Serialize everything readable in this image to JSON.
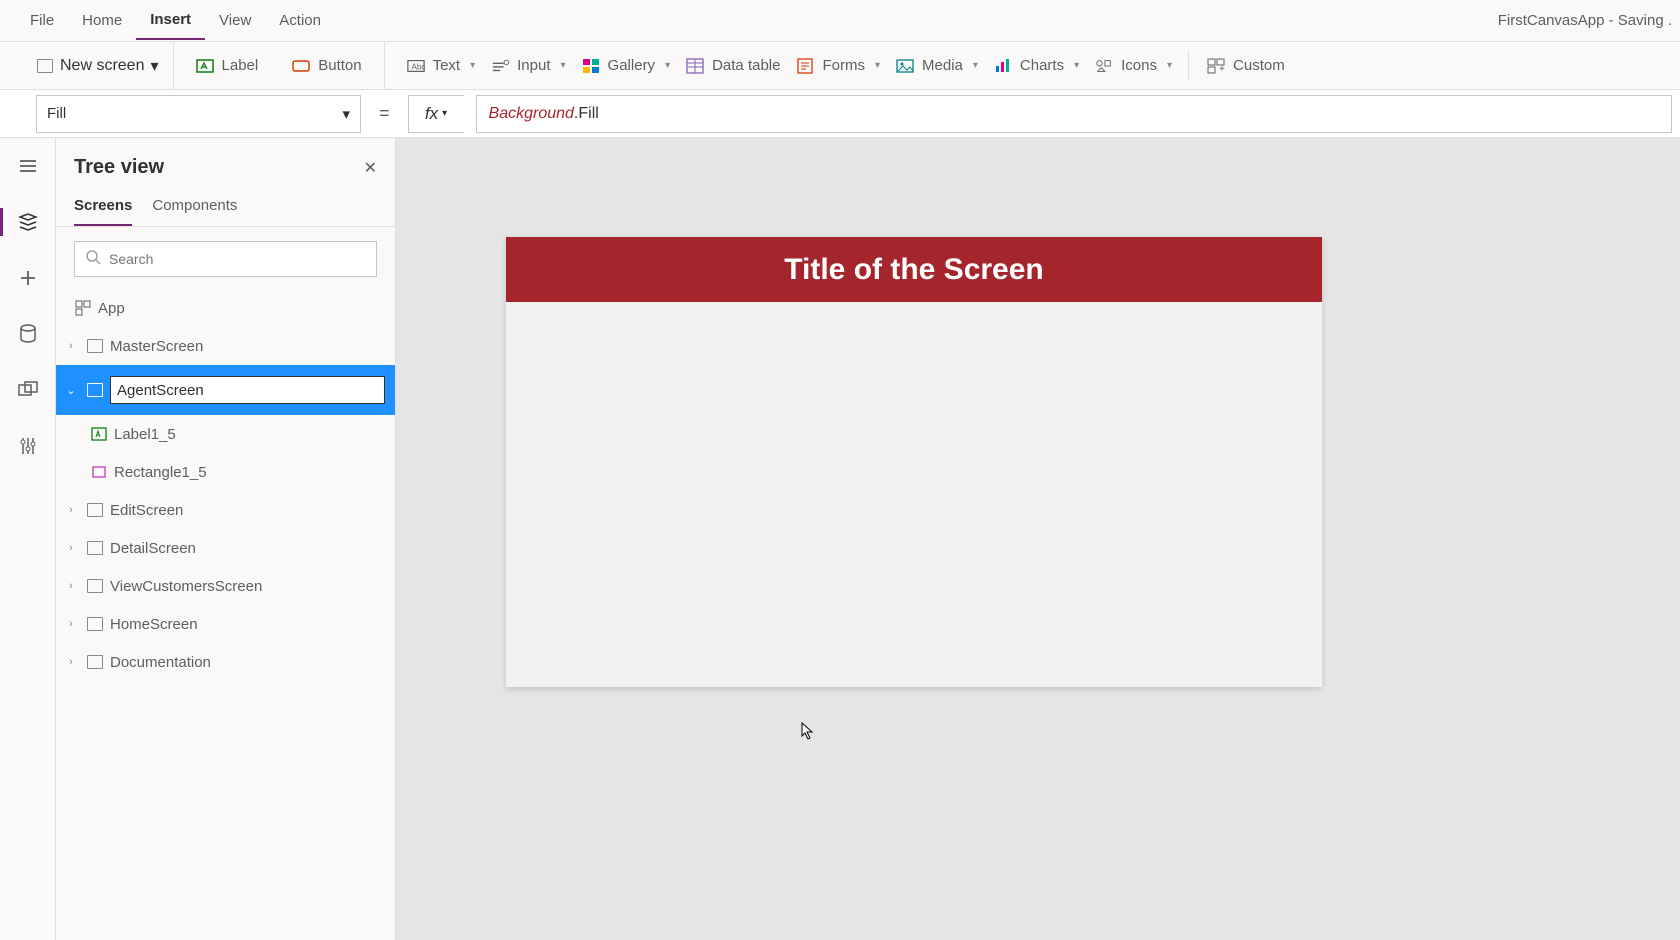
{
  "app": {
    "title": "FirstCanvasApp",
    "status": "Saving ."
  },
  "menu": {
    "file": "File",
    "home": "Home",
    "insert": "Insert",
    "view": "View",
    "action": "Action"
  },
  "ribbon": {
    "newScreen": "New screen",
    "label": "Label",
    "button": "Button",
    "text": "Text",
    "input": "Input",
    "gallery": "Gallery",
    "dataTable": "Data table",
    "forms": "Forms",
    "media": "Media",
    "charts": "Charts",
    "icons": "Icons",
    "custom": "Custom"
  },
  "formula": {
    "property": "Fill",
    "fx": "fx",
    "obj": "Background",
    "dot": ".",
    "prop": "Fill"
  },
  "tree": {
    "title": "Tree view",
    "tabs": {
      "screens": "Screens",
      "components": "Components"
    },
    "searchPlaceholder": "Search",
    "app": "App",
    "items": [
      {
        "label": "MasterScreen"
      },
      {
        "label": "AgentScreen",
        "editing": true
      },
      {
        "label": "Label1_5",
        "child": true,
        "icon": "label"
      },
      {
        "label": "Rectangle1_5",
        "child": true,
        "icon": "rect"
      },
      {
        "label": "EditScreen"
      },
      {
        "label": "DetailScreen"
      },
      {
        "label": "ViewCustomersScreen"
      },
      {
        "label": "HomeScreen"
      },
      {
        "label": "Documentation"
      }
    ]
  },
  "canvas": {
    "title": "Title of the Screen"
  }
}
